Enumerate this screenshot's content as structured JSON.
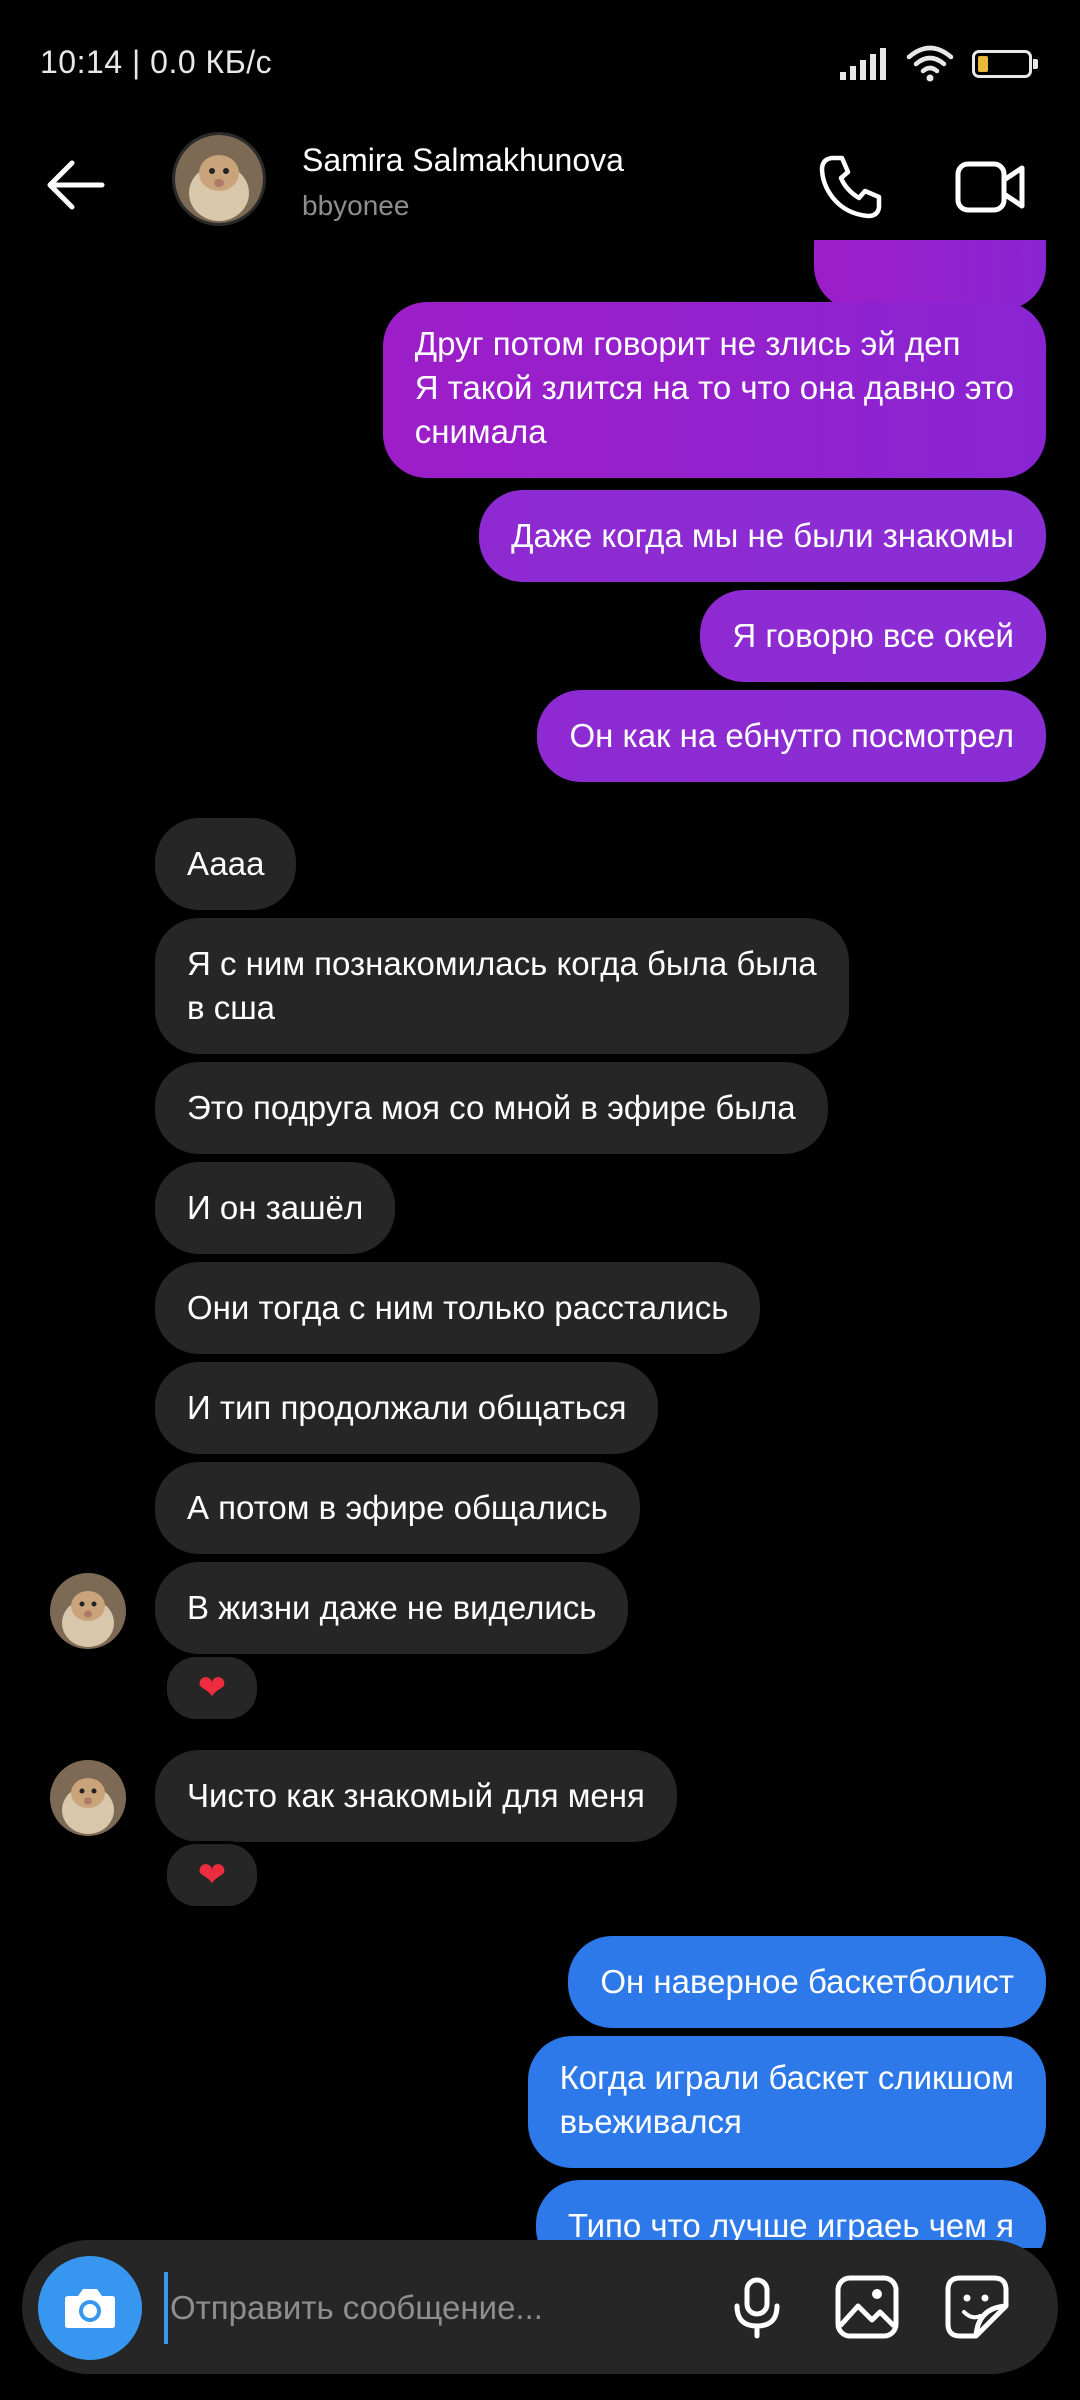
{
  "status_bar": {
    "time_speed": "10:14 | 0.0 КБ/с",
    "battery_level": "6",
    "battery_fraction": 0.2
  },
  "header": {
    "name": "Samira Salmakhunova",
    "username": "bbyonee"
  },
  "messages": [
    {
      "side": "sent",
      "color": "purple",
      "text": "Друг потом говорит не злись эй деп\nЯ такой злится на то что она давно это\nснимала"
    },
    {
      "side": "sent",
      "color": "purple",
      "text": "Даже когда мы не были знакомы"
    },
    {
      "side": "sent",
      "color": "purple",
      "text": "Я говорю все окей"
    },
    {
      "side": "sent",
      "color": "purple",
      "text": "Он как на ебнутго посмотрел"
    },
    {
      "side": "received",
      "text": "Аааа"
    },
    {
      "side": "received",
      "text": "Я с ним познакомилась когда была была\nв сша"
    },
    {
      "side": "received",
      "text": "Это  подруга моя со мной в эфире была"
    },
    {
      "side": "received",
      "text": "И он зашёл"
    },
    {
      "side": "received",
      "text": "Они тогда с ним только расстались"
    },
    {
      "side": "received",
      "text": "И тип продолжали общаться"
    },
    {
      "side": "received",
      "text": "А потом в эфире общались"
    },
    {
      "side": "received",
      "text": "В жизни даже не виделись",
      "reaction": "❤"
    },
    {
      "side": "received",
      "text": "Чисто как знакомый для меня",
      "reaction": "❤"
    },
    {
      "side": "sent",
      "color": "blue",
      "text": "Он наверное баскетболист"
    },
    {
      "side": "sent",
      "color": "blue",
      "text": "Когда играли баскет сликшом\nвьеживался"
    },
    {
      "side": "sent",
      "color": "blue",
      "text": "Типо что лучше играеь чем я"
    }
  ],
  "composer": {
    "placeholder": "Отправить сообщение..."
  },
  "icons": [
    "back-arrow-icon",
    "phone-icon",
    "video-camera-icon",
    "camera-icon",
    "microphone-icon",
    "gallery-icon",
    "sticker-icon"
  ],
  "colors": {
    "sent_purple": "#9d1ec8",
    "sent_blue": "#2d79ea",
    "received": "#262626",
    "accent": "#3797f0",
    "heart": "#ed2d3f"
  }
}
